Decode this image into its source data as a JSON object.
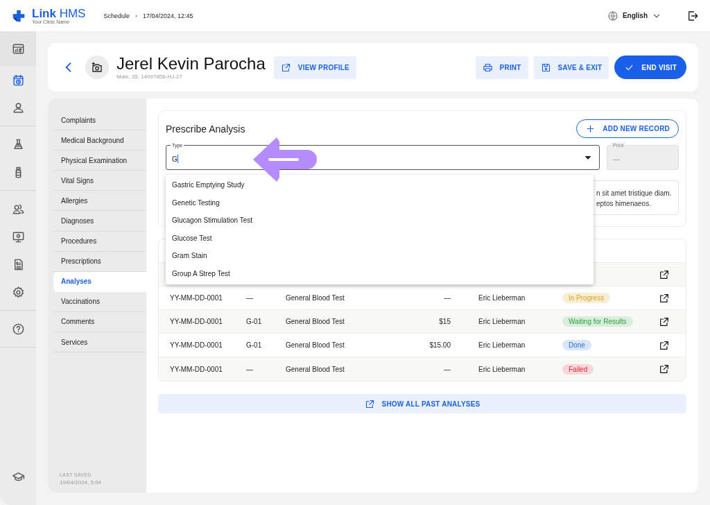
{
  "topbar": {
    "brand": "**Link** HMS",
    "clinic": "Your Clinic Name",
    "breadcrumb": [
      {
        "label": "Schedule"
      },
      {
        "label": "17/04/2024, 12:45"
      }
    ],
    "separator": "›",
    "language": "English"
  },
  "rail": {
    "groups": [
      {
        "items": [
          {
            "selected": false
          },
          {
            "selected": true
          },
          {
            "selected": false
          }
        ]
      },
      {
        "items": [
          {
            "selected": false
          },
          {
            "selected": false
          }
        ]
      },
      {
        "items": [
          {
            "selected": false
          },
          {
            "selected": false
          },
          {
            "selected": false
          },
          {
            "selected": false
          }
        ]
      },
      {
        "items": [
          {
            "selected": false
          }
        ]
      }
    ]
  },
  "patient": {
    "name": "Jerel Kevin Parocha",
    "meta": "Male, 35, 14097856-HJ-27",
    "view_profile": "VIEW PROFILE"
  },
  "actions": [
    {
      "label": "PRINT",
      "kind": "print"
    },
    {
      "label": "SAVE & EXIT",
      "kind": "save"
    },
    {
      "label": "END VISIT",
      "kind": "primary"
    }
  ],
  "sections": [
    {
      "label": "Complaints",
      "selected": false
    },
    {
      "label": "Medical Background",
      "selected": false
    },
    {
      "label": "Physical Examination",
      "selected": false
    },
    {
      "label": "Vital Signs",
      "selected": false
    },
    {
      "label": "Allergies",
      "selected": false
    },
    {
      "label": "Diagnoses",
      "selected": false
    },
    {
      "label": "Procedures",
      "selected": false
    },
    {
      "label": "Prescriptions",
      "selected": false
    },
    {
      "label": "Analyses",
      "selected": true
    },
    {
      "label": "Vaccinations",
      "selected": false
    },
    {
      "label": "Comments",
      "selected": false
    },
    {
      "label": "Services",
      "selected": false
    }
  ],
  "last_saved": {
    "label": "LAST SAVED",
    "value": "19/04/2024, 5:04"
  },
  "prescribe": {
    "title": "Prescribe Analysis",
    "add_button": "ADD NEW RECORD",
    "type_field": {
      "label": "Type",
      "value": "G"
    },
    "price_field": {
      "label": "Price",
      "value": "—"
    },
    "description_lines": [
      "n sit amet tristique diam.",
      "eptos himenaeos."
    ],
    "options": [
      "Gastric Emptying Study",
      "Genetic Testing",
      "Glucagon Stimulation Test",
      "Glucose Test",
      "Gram Stain",
      "Group A Strep Test"
    ]
  },
  "table": {
    "rows": [
      {
        "kind": "covered"
      },
      {
        "kind": "record",
        "id": "YY-MM-DD-0001",
        "code": "—",
        "name": "General Blood Test",
        "price": "—",
        "doctor": "Eric Lieberman",
        "status": "In Progress",
        "color": "#d9a21b"
      },
      {
        "kind": "record",
        "id": "YY-MM-DD-0001",
        "code": "G-01",
        "name": "General Blood Test",
        "price": "$15",
        "doctor": "Eric Lieberman",
        "status": "Waiting for Results",
        "color": "#2e9e3a"
      },
      {
        "kind": "record",
        "id": "YY-MM-DD-0001",
        "code": "G-01",
        "name": "General Blood Test",
        "price": "$15.00",
        "doctor": "Eric Lieberman",
        "status": "Done",
        "color": "#2f6fe0"
      },
      {
        "kind": "record",
        "id": "YY-MM-DD-0001",
        "code": "—",
        "name": "General Blood Test",
        "price": "—",
        "doctor": "Eric Lieberman",
        "status": "Failed",
        "color": "#e0283a"
      }
    ]
  },
  "show_all": "SHOW ALL PAST ANALYSES"
}
